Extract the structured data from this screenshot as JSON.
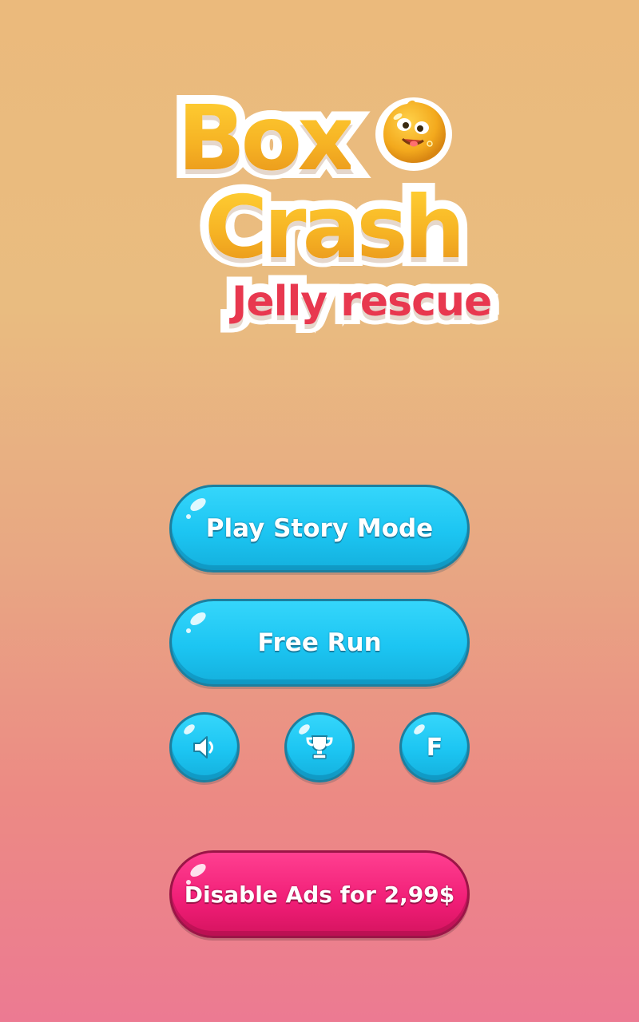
{
  "logo": {
    "line1": "Box",
    "line2": "Crash",
    "subtitle": "Jelly rescue",
    "mascot_icon": "jelly-face-icon"
  },
  "menu": {
    "play_story_label": "Play Story Mode",
    "free_run_label": "Free Run",
    "disable_ads_label": "Disable Ads for 2,99$"
  },
  "icon_buttons": {
    "sound_icon": "speaker-icon",
    "leaderboard_icon": "trophy-icon",
    "facebook_label": "F"
  },
  "colors": {
    "blue_button": "#1cc5f2",
    "pink_button": "#f01d76",
    "logo_yellow": "#f6b324",
    "subtitle_red": "#e8384f"
  }
}
